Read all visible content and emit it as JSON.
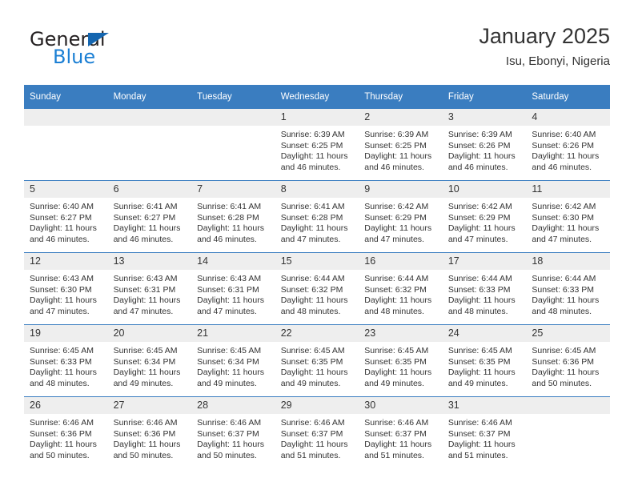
{
  "brand": {
    "name_part1": "General",
    "name_part2": "Blue",
    "primary_color": "#1b7fd4",
    "triangle_color": "#1566b0"
  },
  "header": {
    "title": "January 2025",
    "subtitle": "Isu, Ebonyi, Nigeria"
  },
  "calendar": {
    "header_color": "#3a7dc0",
    "daynum_background": "#eeeeee",
    "weekday_labels": [
      "Sunday",
      "Monday",
      "Tuesday",
      "Wednesday",
      "Thursday",
      "Friday",
      "Saturday"
    ],
    "weeks": [
      [
        {
          "day": "",
          "sunrise": "",
          "sunset": "",
          "daylight_line1": "",
          "daylight_line2": "",
          "empty": true
        },
        {
          "day": "",
          "sunrise": "",
          "sunset": "",
          "daylight_line1": "",
          "daylight_line2": "",
          "empty": true
        },
        {
          "day": "",
          "sunrise": "",
          "sunset": "",
          "daylight_line1": "",
          "daylight_line2": "",
          "empty": true
        },
        {
          "day": "1",
          "sunrise": "Sunrise: 6:39 AM",
          "sunset": "Sunset: 6:25 PM",
          "daylight_line1": "Daylight: 11 hours",
          "daylight_line2": "and 46 minutes.",
          "empty": false
        },
        {
          "day": "2",
          "sunrise": "Sunrise: 6:39 AM",
          "sunset": "Sunset: 6:25 PM",
          "daylight_line1": "Daylight: 11 hours",
          "daylight_line2": "and 46 minutes.",
          "empty": false
        },
        {
          "day": "3",
          "sunrise": "Sunrise: 6:39 AM",
          "sunset": "Sunset: 6:26 PM",
          "daylight_line1": "Daylight: 11 hours",
          "daylight_line2": "and 46 minutes.",
          "empty": false
        },
        {
          "day": "4",
          "sunrise": "Sunrise: 6:40 AM",
          "sunset": "Sunset: 6:26 PM",
          "daylight_line1": "Daylight: 11 hours",
          "daylight_line2": "and 46 minutes.",
          "empty": false
        }
      ],
      [
        {
          "day": "5",
          "sunrise": "Sunrise: 6:40 AM",
          "sunset": "Sunset: 6:27 PM",
          "daylight_line1": "Daylight: 11 hours",
          "daylight_line2": "and 46 minutes.",
          "empty": false
        },
        {
          "day": "6",
          "sunrise": "Sunrise: 6:41 AM",
          "sunset": "Sunset: 6:27 PM",
          "daylight_line1": "Daylight: 11 hours",
          "daylight_line2": "and 46 minutes.",
          "empty": false
        },
        {
          "day": "7",
          "sunrise": "Sunrise: 6:41 AM",
          "sunset": "Sunset: 6:28 PM",
          "daylight_line1": "Daylight: 11 hours",
          "daylight_line2": "and 46 minutes.",
          "empty": false
        },
        {
          "day": "8",
          "sunrise": "Sunrise: 6:41 AM",
          "sunset": "Sunset: 6:28 PM",
          "daylight_line1": "Daylight: 11 hours",
          "daylight_line2": "and 47 minutes.",
          "empty": false
        },
        {
          "day": "9",
          "sunrise": "Sunrise: 6:42 AM",
          "sunset": "Sunset: 6:29 PM",
          "daylight_line1": "Daylight: 11 hours",
          "daylight_line2": "and 47 minutes.",
          "empty": false
        },
        {
          "day": "10",
          "sunrise": "Sunrise: 6:42 AM",
          "sunset": "Sunset: 6:29 PM",
          "daylight_line1": "Daylight: 11 hours",
          "daylight_line2": "and 47 minutes.",
          "empty": false
        },
        {
          "day": "11",
          "sunrise": "Sunrise: 6:42 AM",
          "sunset": "Sunset: 6:30 PM",
          "daylight_line1": "Daylight: 11 hours",
          "daylight_line2": "and 47 minutes.",
          "empty": false
        }
      ],
      [
        {
          "day": "12",
          "sunrise": "Sunrise: 6:43 AM",
          "sunset": "Sunset: 6:30 PM",
          "daylight_line1": "Daylight: 11 hours",
          "daylight_line2": "and 47 minutes.",
          "empty": false
        },
        {
          "day": "13",
          "sunrise": "Sunrise: 6:43 AM",
          "sunset": "Sunset: 6:31 PM",
          "daylight_line1": "Daylight: 11 hours",
          "daylight_line2": "and 47 minutes.",
          "empty": false
        },
        {
          "day": "14",
          "sunrise": "Sunrise: 6:43 AM",
          "sunset": "Sunset: 6:31 PM",
          "daylight_line1": "Daylight: 11 hours",
          "daylight_line2": "and 47 minutes.",
          "empty": false
        },
        {
          "day": "15",
          "sunrise": "Sunrise: 6:44 AM",
          "sunset": "Sunset: 6:32 PM",
          "daylight_line1": "Daylight: 11 hours",
          "daylight_line2": "and 48 minutes.",
          "empty": false
        },
        {
          "day": "16",
          "sunrise": "Sunrise: 6:44 AM",
          "sunset": "Sunset: 6:32 PM",
          "daylight_line1": "Daylight: 11 hours",
          "daylight_line2": "and 48 minutes.",
          "empty": false
        },
        {
          "day": "17",
          "sunrise": "Sunrise: 6:44 AM",
          "sunset": "Sunset: 6:33 PM",
          "daylight_line1": "Daylight: 11 hours",
          "daylight_line2": "and 48 minutes.",
          "empty": false
        },
        {
          "day": "18",
          "sunrise": "Sunrise: 6:44 AM",
          "sunset": "Sunset: 6:33 PM",
          "daylight_line1": "Daylight: 11 hours",
          "daylight_line2": "and 48 minutes.",
          "empty": false
        }
      ],
      [
        {
          "day": "19",
          "sunrise": "Sunrise: 6:45 AM",
          "sunset": "Sunset: 6:33 PM",
          "daylight_line1": "Daylight: 11 hours",
          "daylight_line2": "and 48 minutes.",
          "empty": false
        },
        {
          "day": "20",
          "sunrise": "Sunrise: 6:45 AM",
          "sunset": "Sunset: 6:34 PM",
          "daylight_line1": "Daylight: 11 hours",
          "daylight_line2": "and 49 minutes.",
          "empty": false
        },
        {
          "day": "21",
          "sunrise": "Sunrise: 6:45 AM",
          "sunset": "Sunset: 6:34 PM",
          "daylight_line1": "Daylight: 11 hours",
          "daylight_line2": "and 49 minutes.",
          "empty": false
        },
        {
          "day": "22",
          "sunrise": "Sunrise: 6:45 AM",
          "sunset": "Sunset: 6:35 PM",
          "daylight_line1": "Daylight: 11 hours",
          "daylight_line2": "and 49 minutes.",
          "empty": false
        },
        {
          "day": "23",
          "sunrise": "Sunrise: 6:45 AM",
          "sunset": "Sunset: 6:35 PM",
          "daylight_line1": "Daylight: 11 hours",
          "daylight_line2": "and 49 minutes.",
          "empty": false
        },
        {
          "day": "24",
          "sunrise": "Sunrise: 6:45 AM",
          "sunset": "Sunset: 6:35 PM",
          "daylight_line1": "Daylight: 11 hours",
          "daylight_line2": "and 49 minutes.",
          "empty": false
        },
        {
          "day": "25",
          "sunrise": "Sunrise: 6:45 AM",
          "sunset": "Sunset: 6:36 PM",
          "daylight_line1": "Daylight: 11 hours",
          "daylight_line2": "and 50 minutes.",
          "empty": false
        }
      ],
      [
        {
          "day": "26",
          "sunrise": "Sunrise: 6:46 AM",
          "sunset": "Sunset: 6:36 PM",
          "daylight_line1": "Daylight: 11 hours",
          "daylight_line2": "and 50 minutes.",
          "empty": false
        },
        {
          "day": "27",
          "sunrise": "Sunrise: 6:46 AM",
          "sunset": "Sunset: 6:36 PM",
          "daylight_line1": "Daylight: 11 hours",
          "daylight_line2": "and 50 minutes.",
          "empty": false
        },
        {
          "day": "28",
          "sunrise": "Sunrise: 6:46 AM",
          "sunset": "Sunset: 6:37 PM",
          "daylight_line1": "Daylight: 11 hours",
          "daylight_line2": "and 50 minutes.",
          "empty": false
        },
        {
          "day": "29",
          "sunrise": "Sunrise: 6:46 AM",
          "sunset": "Sunset: 6:37 PM",
          "daylight_line1": "Daylight: 11 hours",
          "daylight_line2": "and 51 minutes.",
          "empty": false
        },
        {
          "day": "30",
          "sunrise": "Sunrise: 6:46 AM",
          "sunset": "Sunset: 6:37 PM",
          "daylight_line1": "Daylight: 11 hours",
          "daylight_line2": "and 51 minutes.",
          "empty": false
        },
        {
          "day": "31",
          "sunrise": "Sunrise: 6:46 AM",
          "sunset": "Sunset: 6:37 PM",
          "daylight_line1": "Daylight: 11 hours",
          "daylight_line2": "and 51 minutes.",
          "empty": false
        },
        {
          "day": "",
          "sunrise": "",
          "sunset": "",
          "daylight_line1": "",
          "daylight_line2": "",
          "empty": true
        }
      ]
    ]
  }
}
